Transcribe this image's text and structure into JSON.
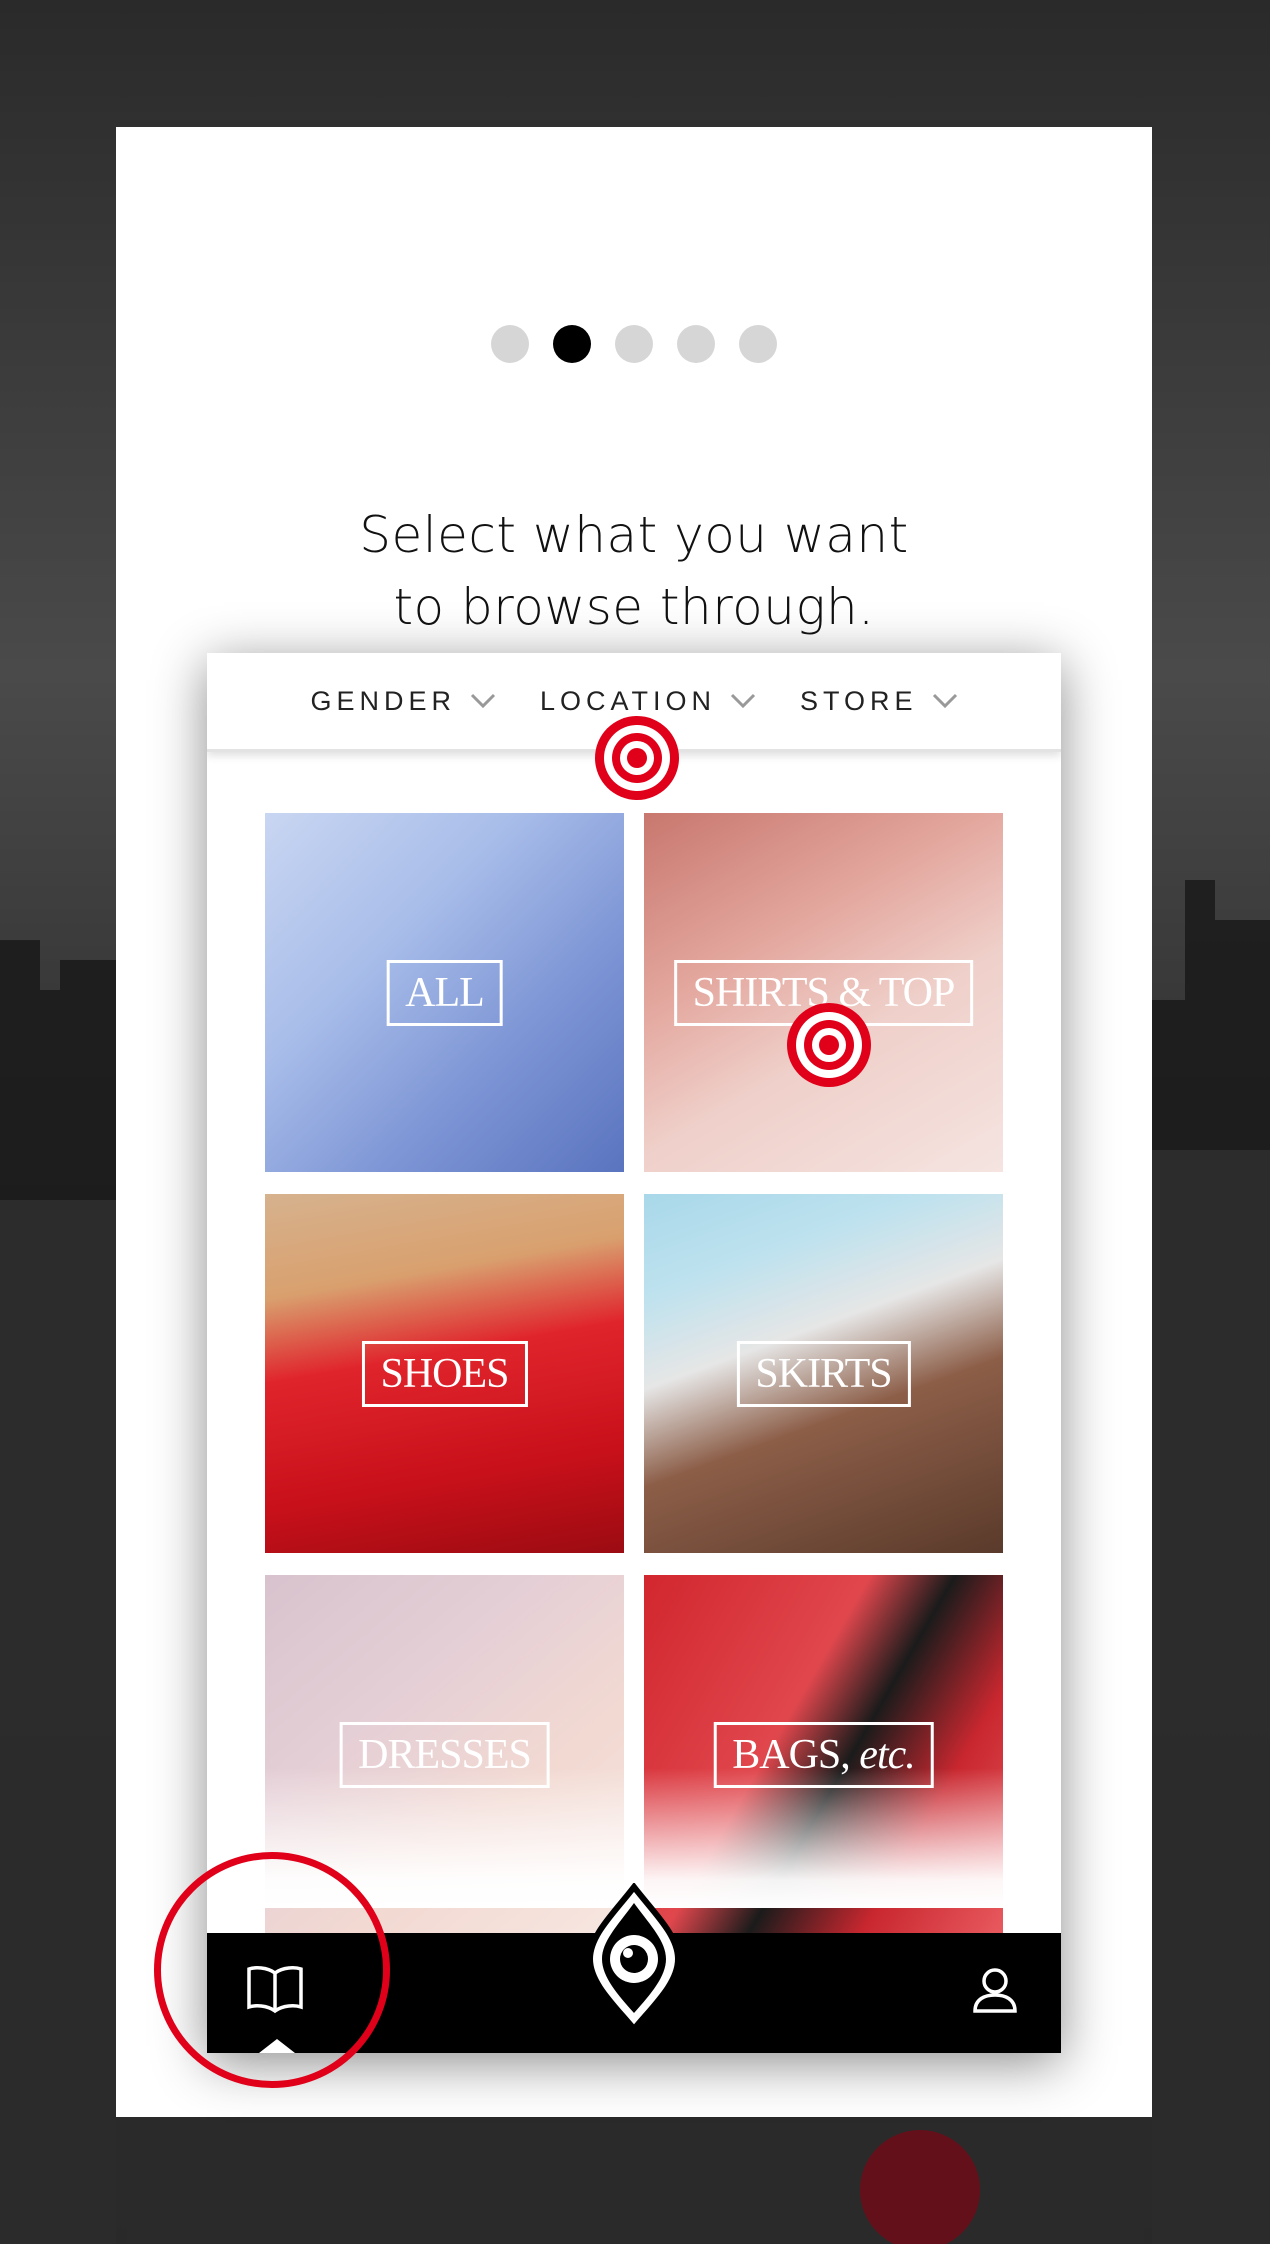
{
  "pager": {
    "count": 5,
    "active_index": 1
  },
  "headline": {
    "line1": "Select what you want",
    "line2": "to browse through."
  },
  "filters": [
    {
      "label": "GENDER"
    },
    {
      "label": "LOCATION"
    },
    {
      "label": "STORE"
    }
  ],
  "categories": [
    {
      "label": "ALL"
    },
    {
      "label": "SHIRTS & TOP"
    },
    {
      "label": "SHOES"
    },
    {
      "label": "SKIRTS"
    },
    {
      "label": "DRESSES"
    },
    {
      "label_main": "BAGS,",
      "label_italic": "etc."
    }
  ],
  "tabbar": {
    "left_icon": "book-icon",
    "center_icon": "eye-logo-icon",
    "right_icon": "user-icon"
  },
  "colors": {
    "accent_red": "#e0001a",
    "active_dot": "#000000",
    "inactive_dot": "#d6d6d6",
    "tabbar_bg": "#000000"
  }
}
